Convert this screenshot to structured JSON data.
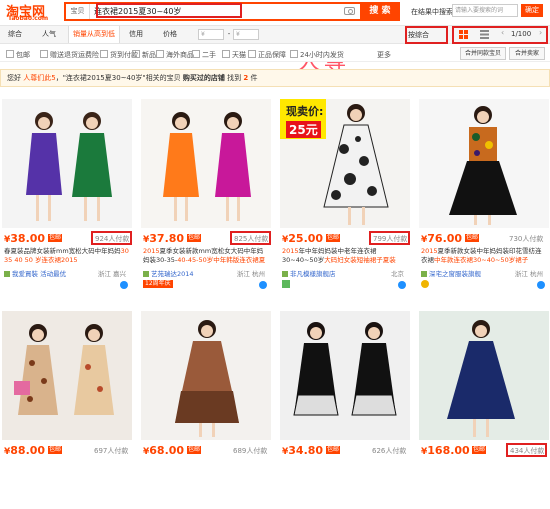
{
  "header": {
    "logo": "淘宝网",
    "logo_sub": "Taobao.com",
    "search_scope": "宝贝",
    "search_value": "连衣裙2015夏30~40岁",
    "search_button": "搜 索",
    "in_result_label": "在结果中搜索",
    "in_result_placeholder": "请输入要搜索的词",
    "confirm_button": "确定"
  },
  "sortbar": {
    "items": [
      "综合",
      "人气",
      "销量从高到低",
      "信用",
      "价格",
      "¥",
      "-",
      "¥"
    ],
    "watermark": "人尊",
    "default_sort": "按综合",
    "page": "1/100",
    "prev": "‹",
    "next": "›"
  },
  "filters": {
    "checks": [
      "包邮",
      "赠送退货运费险",
      "货到付款",
      "新品",
      "海外商品",
      "二手",
      "天猫",
      "正品保障",
      "24小时内发货"
    ],
    "more": "更多",
    "btn_merge": "合并同款宝贝",
    "btn_seller": "合并卖家"
  },
  "notice": {
    "prefix": "您好",
    "user": "人尊们此5",
    "mid1": "，\"连衣裙2015夏30~40岁\"相关的宝贝",
    "mid2": "购买过的店铺",
    "mid3": "找到",
    "count": "2",
    "suffix": "件"
  },
  "colors": {
    "accent": "#ff4400",
    "highlight_box": "#e02020",
    "link": "#3366cc"
  },
  "products": [
    {
      "yen": "¥",
      "price": "38.00",
      "badge": "包邮",
      "sales": "924人付款",
      "title_hl1": "",
      "title_pre": "春夏装品牌女装新mm宽松大码中年妈妈",
      "title_hl2": "30 35 40 50 岁连衣裙2015",
      "shop": "我爱買裝 活动最优",
      "loc": "浙江 嘉兴",
      "tag": "",
      "tag_type": "none"
    },
    {
      "yen": "¥",
      "price": "37.80",
      "badge": "包邮",
      "sales": "825人付款",
      "title_hl1": "2015",
      "title_pre": "夏季女装新款mm宽松女大码中年妈妈装30-35-",
      "title_hl2": "40-45-50岁中年韩版连衣裙夏",
      "shop": "艺苑瑞达2014",
      "loc": "浙江 杭州",
      "tag": "12周年庆",
      "tag_type": "red"
    },
    {
      "yen": "¥",
      "price": "25.00",
      "badge": "包邮",
      "sales": "799人付款",
      "title_hl1": "2015",
      "title_pre": "年中年妈妈装中老年连衣裙30~40~50岁",
      "title_hl2": "大码妇女装短袖裙子夏装",
      "shop": "非凡模樣旗舰店",
      "loc": "北京",
      "tag": "",
      "tag_type": "green",
      "promo_label": "现卖价:",
      "promo_price": "25元"
    },
    {
      "yen": "¥",
      "price": "76.00",
      "badge": "包邮",
      "sales": "730人付款",
      "title_hl1": "2015",
      "title_pre": "夏季新款女装中年妈妈装印花雪纺连衣裙",
      "title_hl2": "中年款连衣裙30~40~50岁裙子",
      "shop": "深宅之窗服装旗舰",
      "loc": "浙江 杭州",
      "tag": "",
      "tag_type": "gold"
    },
    {
      "yen": "¥",
      "price": "88.00",
      "badge": "包邮",
      "sales": "697人付款"
    },
    {
      "yen": "¥",
      "price": "68.00",
      "badge": "包邮",
      "sales": "689人付款"
    },
    {
      "yen": "¥",
      "price": "34.80",
      "badge": "包邮",
      "sales": "626人付款"
    },
    {
      "yen": "¥",
      "price": "168.00",
      "badge": "包邮",
      "sales": "434人付款"
    }
  ]
}
